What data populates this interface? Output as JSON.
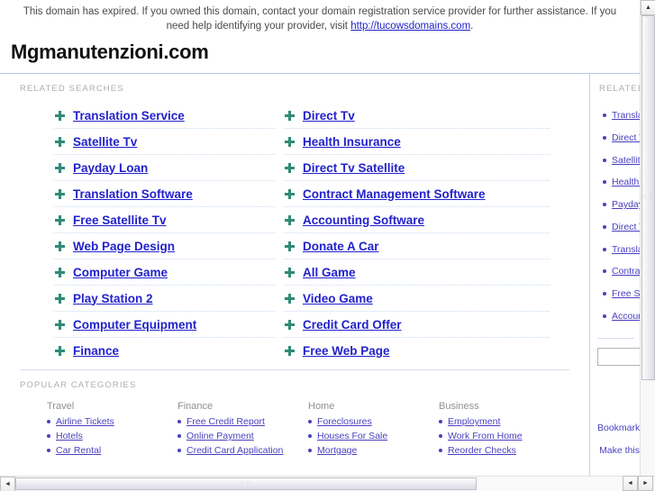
{
  "banner": {
    "text_before": "This domain has expired. If you owned this domain, contact your domain registration service provider for further assistance. If you need help identifying your provider, visit ",
    "link_text": "http://tucowsdomains.com",
    "text_after": "."
  },
  "header": {
    "domain_title": "Mgmanutenzioni.com"
  },
  "sections": {
    "related_searches_label": "RELATED SEARCHES",
    "popular_categories_label": "POPULAR CATEGORIES",
    "sidebar_related_label": "RELATED"
  },
  "related_searches": {
    "left_column": [
      "Translation Service",
      "Satellite Tv",
      "Payday Loan",
      "Translation Software",
      "Free Satellite Tv",
      "Web Page Design",
      "Computer Game",
      "Play Station 2",
      "Computer Equipment",
      "Finance"
    ],
    "right_column": [
      "Direct Tv",
      "Health Insurance",
      "Direct Tv Satellite",
      "Contract Management Software",
      "Accounting Software",
      "Donate A Car",
      "All Game",
      "Video Game",
      "Credit Card Offer",
      "Free Web Page"
    ]
  },
  "popular_categories": [
    {
      "heading": "Travel",
      "links": [
        "Airline Tickets",
        "Hotels",
        "Car Rental"
      ]
    },
    {
      "heading": "Finance",
      "links": [
        "Free Credit Report",
        "Online Payment",
        "Credit Card Application"
      ]
    },
    {
      "heading": "Home",
      "links": [
        "Foreclosures",
        "Houses For Sale",
        "Mortgage"
      ]
    },
    {
      "heading": "Business",
      "links": [
        "Employment",
        "Work From Home",
        "Reorder Checks"
      ]
    }
  ],
  "sidebar": {
    "items": [
      "Translation Service",
      "Direct Tv",
      "Satellite Tv",
      "Health Insurance",
      "Payday Loan",
      "Direct Tv Satellite",
      "Translation Software",
      "Contract Management Software",
      "Free Satellite Tv",
      "Accounting Software"
    ],
    "search_value": "",
    "search_placeholder": "",
    "footer_links": [
      "Bookmark",
      "Make this"
    ]
  },
  "scrollbars": {
    "up_arrow": "▲",
    "down_arrow": "▼",
    "left_arrow": "◄",
    "right_arrow": "►",
    "grip": "⁙⁙"
  },
  "colors": {
    "link_blue": "#2222CC",
    "link_purple": "#4B3FBF",
    "bullet_green": "#2E8B77",
    "label_gray": "#ADADAD",
    "rule_blue": "#B9C4E6"
  }
}
